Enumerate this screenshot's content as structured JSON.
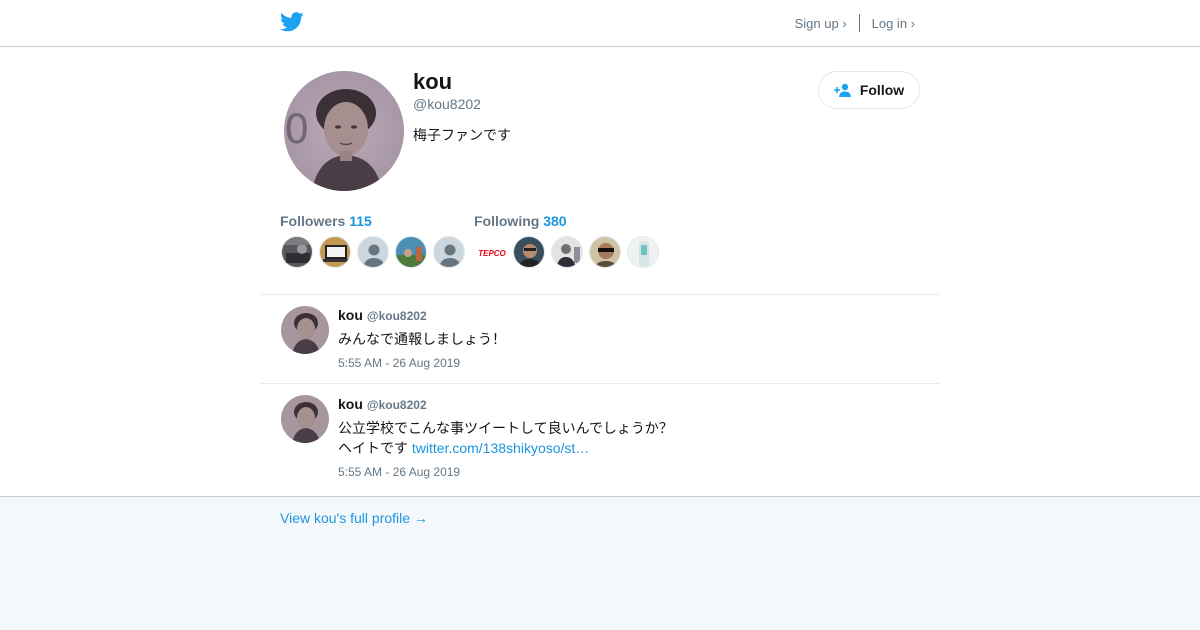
{
  "header": {
    "signup_label": "Sign up ›",
    "login_label": "Log in ›",
    "logo_icon": "twitter-bird-icon"
  },
  "profile": {
    "name": "kou",
    "handle": "@kou8202",
    "bio": "梅子ファンです",
    "follow_label": "Follow",
    "followers_label": "Followers",
    "followers_count": "115",
    "following_label": "Following",
    "following_count": "380",
    "following_thumb_text": "TEPCO"
  },
  "tweets": [
    {
      "name": "kou",
      "handle": "@kou8202",
      "text_line1": "みんなで通報しましょう！",
      "time": "5:55 AM - 26 Aug 2019"
    },
    {
      "name": "kou",
      "handle": "@kou8202",
      "text_line1": "公立学校でこんな事ツイートして良いんでしょうか？",
      "text_line2": "ヘイトです",
      "link": "twitter.com/138shikyoso/st…",
      "time": "5:55 AM - 26 Aug 2019"
    }
  ],
  "footer": {
    "full_profile_label": "View kou's full profile →"
  },
  "colors": {
    "accent": "#1b95e0",
    "twitter_blue": "#1da1f2",
    "muted": "#657786"
  }
}
